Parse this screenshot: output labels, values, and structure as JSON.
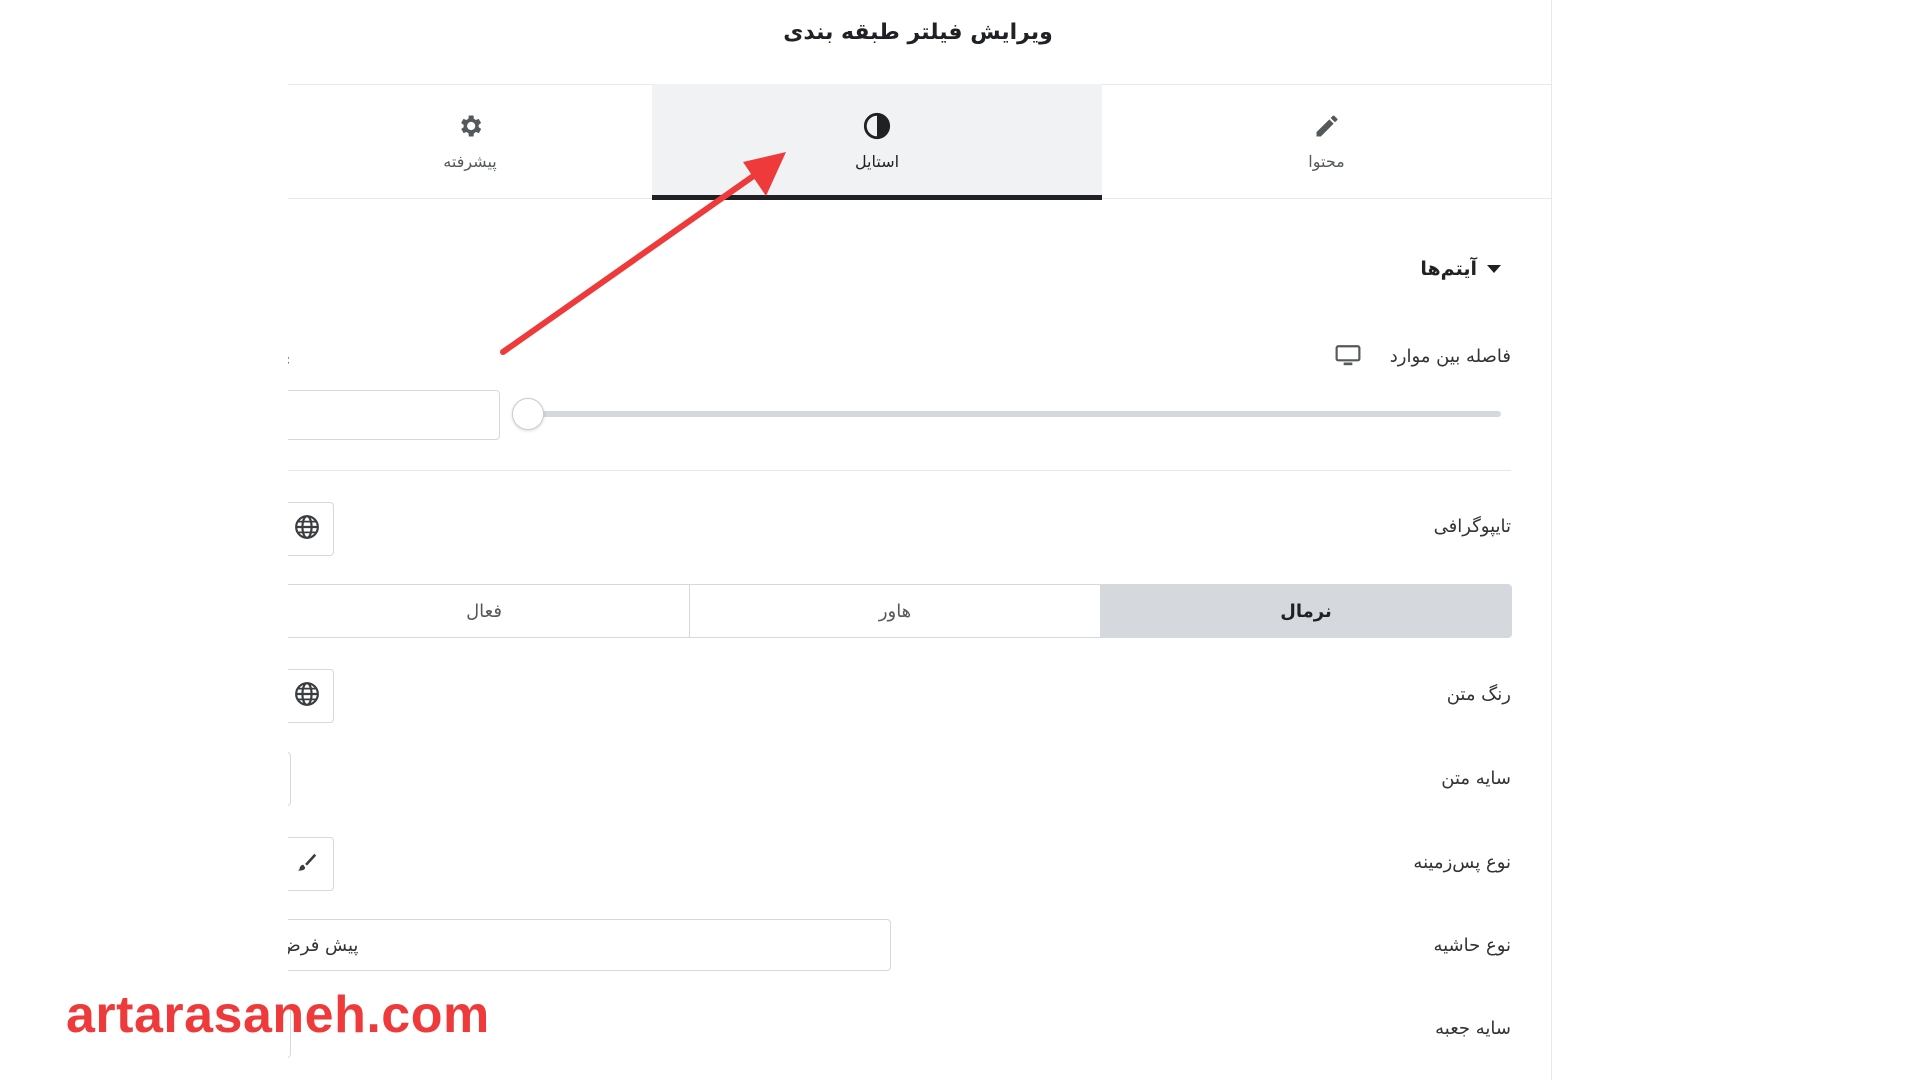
{
  "header": {
    "title": "ویرایش فیلتر طبقه بندی"
  },
  "tabs": [
    {
      "label": "محتوا",
      "icon": "pencil-icon"
    },
    {
      "label": "استایل",
      "icon": "contrast-icon",
      "active": true
    },
    {
      "label": "پیشرفته",
      "icon": "gear-icon"
    }
  ],
  "section": {
    "title": "آیتم‌ها",
    "icon": "caret-down-icon"
  },
  "controls": {
    "spacing_label": "فاصله بین موارد",
    "spacing_device_icon": "desktop-icon",
    "typography_label": "تایپوگرافی",
    "states": [
      "نرمال",
      "هاور",
      "فعال"
    ],
    "active_state": "نرمال",
    "text_color_label": "رنگ متن",
    "text_shadow_label": "سایه متن",
    "background_type_label": "نوع پس‌زمینه",
    "border_type_label": "نوع حاشیه",
    "border_type_value": "پیش فرض",
    "box_shadow_label": "سایه جعبه"
  },
  "colors": {
    "accent": "#ee3a3a",
    "active_tab_bg": "#f1f2f3",
    "active_state_bg": "#d5d8dc"
  },
  "watermark": "artarasaneh.com"
}
